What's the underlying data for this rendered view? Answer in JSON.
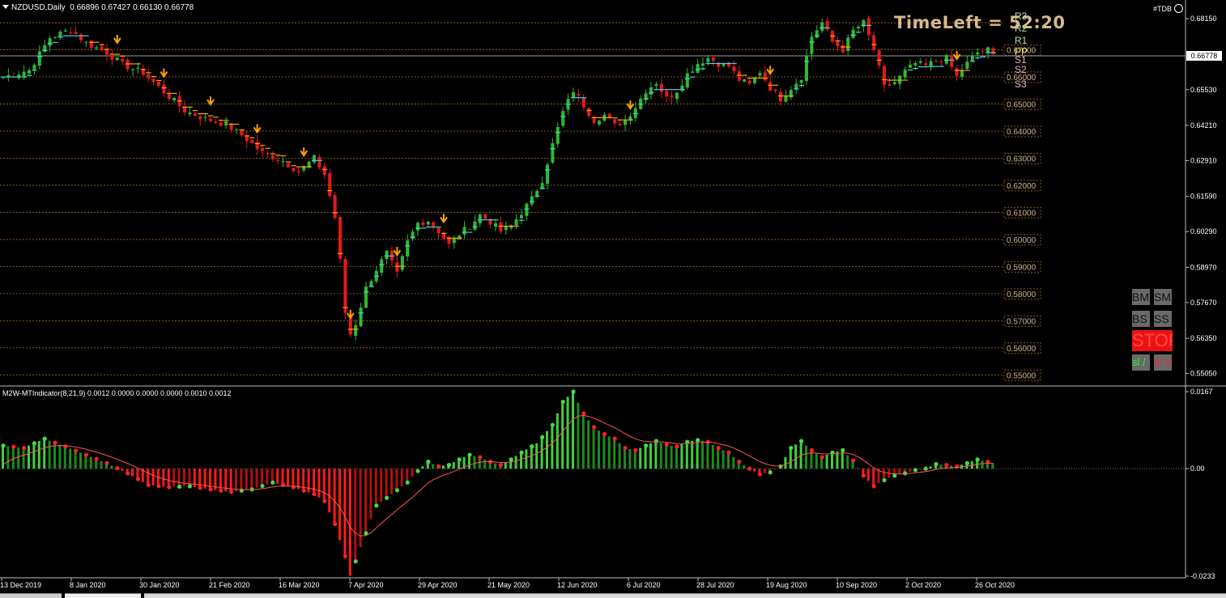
{
  "header": {
    "symbol_label": "NZDUSD,Daily",
    "ohlc": "0.66896 0.67427 0.66130 0.66778"
  },
  "indicator": {
    "title": "M2W-MTIndicator(8,21,9) 0.0012 0.0000 0.0000 0.0000 0.0010 0.0012"
  },
  "timeleft": "TimeLeft = 52:20",
  "tdb_label": "#TDB",
  "pivots": [
    {
      "label": "R3",
      "color": "#b8e0a8"
    },
    {
      "label": "R2",
      "color": "#b8e0a8"
    },
    {
      "label": "R1",
      "color": "#b8e0a8"
    },
    {
      "label": "PP",
      "color": "#f0e070"
    },
    {
      "label": "S1",
      "color": "#e8b8b8"
    },
    {
      "label": "S2",
      "color": "#e8b8b8"
    },
    {
      "label": "S3",
      "color": "#e8b8b8"
    }
  ],
  "buttons": [
    {
      "label": "BM"
    },
    {
      "label": "SM"
    },
    {
      "label": "BS"
    },
    {
      "label": "SS"
    }
  ],
  "stop_label": "STOP",
  "sl_buttons": [
    {
      "label": "sl / "
    },
    {
      "label": "sl V"
    }
  ],
  "colors": {
    "bull": "#2dbb2d",
    "bear": "#e81818",
    "ma_up": "#3ad7e8",
    "ma_down": "#ffa500",
    "grid": "#8a5a1e",
    "dot_green": "#44dd44",
    "dot_red": "#ff2020",
    "signal_line": "#ff5555"
  },
  "chart_data": [
    {
      "type": "candlestick",
      "title": "NZDUSD,Daily",
      "ylim": [
        0.5465,
        0.6845
      ],
      "price_ticks": [
        "0.68150",
        "0.66778",
        "0.65530",
        "0.64210",
        "0.62910",
        "0.61590",
        "0.60290",
        "0.58970",
        "0.57670",
        "0.56350",
        "0.55050"
      ],
      "grid_levels": [
        "0.55000",
        "0.56000",
        "0.57000",
        "0.58000",
        "0.59000",
        "0.60000",
        "0.61000",
        "0.62000",
        "0.63000",
        "0.64000",
        "0.65000",
        "0.66000",
        "0.67000",
        "0.68000"
      ],
      "grid_label_levels": [
        "0.55000",
        "0.56000",
        "0.57000",
        "0.58000",
        "0.59000",
        "0.60000",
        "0.61000",
        "0.62000",
        "0.63000",
        "0.64000",
        "0.65000",
        "0.66000",
        "0.67000"
      ],
      "current_price": "0.66778",
      "x_ticks": [
        "13 Dec 2019",
        "8 Jan 2020",
        "30 Jan 2020",
        "21 Feb 2020",
        "16 Mar 2020",
        "7 Apr 2020",
        "29 Apr 2020",
        "21 May 2020",
        "12 Jun 2020",
        "6 Jul 2020",
        "28 Jul 2020",
        "19 Aug 2020",
        "10 Sep 2020",
        "2 Oct 2020",
        "26 Oct 2020"
      ],
      "close_path": [
        [
          0,
          0.66
        ],
        [
          5,
          0.6625
        ],
        [
          9,
          0.6745
        ],
        [
          13,
          0.6775
        ],
        [
          16,
          0.6725
        ],
        [
          20,
          0.669
        ],
        [
          23,
          0.6645
        ],
        [
          27,
          0.6615
        ],
        [
          31,
          0.6545
        ],
        [
          35,
          0.6475
        ],
        [
          39,
          0.6445
        ],
        [
          43,
          0.6425
        ],
        [
          46,
          0.6385
        ],
        [
          50,
          0.632
        ],
        [
          54,
          0.629
        ],
        [
          57,
          0.625
        ],
        [
          60,
          0.63
        ],
        [
          62,
          0.624
        ],
        [
          64,
          0.608
        ],
        [
          65,
          0.592
        ],
        [
          66,
          0.573
        ],
        [
          67,
          0.565
        ],
        [
          68,
          0.569
        ],
        [
          70,
          0.582
        ],
        [
          72,
          0.589
        ],
        [
          74,
          0.595
        ],
        [
          76,
          0.587
        ],
        [
          78,
          0.599
        ],
        [
          80,
          0.606
        ],
        [
          82,
          0.607
        ],
        [
          84,
          0.603
        ],
        [
          86,
          0.598
        ],
        [
          88,
          0.602
        ],
        [
          90,
          0.605
        ],
        [
          92,
          0.609
        ],
        [
          94,
          0.6065
        ],
        [
          96,
          0.603
        ],
        [
          98,
          0.605
        ],
        [
          100,
          0.61
        ],
        [
          102,
          0.615
        ],
        [
          104,
          0.622
        ],
        [
          106,
          0.635
        ],
        [
          108,
          0.647
        ],
        [
          110,
          0.655
        ],
        [
          112,
          0.6495
        ],
        [
          114,
          0.644
        ],
        [
          116,
          0.646
        ],
        [
          118,
          0.642
        ],
        [
          120,
          0.644
        ],
        [
          122,
          0.649
        ],
        [
          124,
          0.655
        ],
        [
          126,
          0.658
        ],
        [
          128,
          0.652
        ],
        [
          130,
          0.655
        ],
        [
          132,
          0.661
        ],
        [
          134,
          0.665
        ],
        [
          136,
          0.667
        ],
        [
          138,
          0.665
        ],
        [
          140,
          0.664
        ],
        [
          142,
          0.659
        ],
        [
          144,
          0.657
        ],
        [
          146,
          0.662
        ],
        [
          148,
          0.656
        ],
        [
          150,
          0.652
        ],
        [
          152,
          0.656
        ],
        [
          154,
          0.66
        ],
        [
          156,
          0.675
        ],
        [
          158,
          0.68
        ],
        [
          160,
          0.673
        ],
        [
          162,
          0.67
        ],
        [
          164,
          0.677
        ],
        [
          166,
          0.68
        ],
        [
          168,
          0.67
        ],
        [
          170,
          0.656
        ],
        [
          172,
          0.658
        ],
        [
          174,
          0.662
        ],
        [
          176,
          0.665
        ],
        [
          178,
          0.664
        ],
        [
          180,
          0.666
        ],
        [
          182,
          0.667
        ],
        [
          184,
          0.66
        ],
        [
          186,
          0.665
        ],
        [
          188,
          0.669
        ],
        [
          190,
          0.67
        ],
        [
          191,
          0.6678
        ]
      ],
      "macd_hist_path": [
        [
          0,
          0.005
        ],
        [
          4,
          0.0045
        ],
        [
          8,
          0.0065
        ],
        [
          12,
          0.0048
        ],
        [
          16,
          0.003
        ],
        [
          20,
          0.0012
        ],
        [
          24,
          -0.001
        ],
        [
          28,
          -0.0035
        ],
        [
          32,
          -0.004
        ],
        [
          36,
          -0.0038
        ],
        [
          40,
          -0.0045
        ],
        [
          44,
          -0.005
        ],
        [
          48,
          -0.0045
        ],
        [
          52,
          -0.003
        ],
        [
          56,
          -0.004
        ],
        [
          60,
          -0.0055
        ],
        [
          62,
          -0.007
        ],
        [
          64,
          -0.012
        ],
        [
          66,
          -0.019
        ],
        [
          67,
          -0.0232
        ],
        [
          69,
          -0.017
        ],
        [
          72,
          -0.008
        ],
        [
          75,
          -0.0055
        ],
        [
          78,
          -0.003
        ],
        [
          80,
          -0.0005
        ],
        [
          82,
          0.0015
        ],
        [
          84,
          0.0005
        ],
        [
          86,
          0.0008
        ],
        [
          88,
          0.002
        ],
        [
          90,
          0.003
        ],
        [
          92,
          0.0025
        ],
        [
          94,
          0.0015
        ],
        [
          96,
          0.0008
        ],
        [
          98,
          0.002
        ],
        [
          100,
          0.0035
        ],
        [
          103,
          0.0055
        ],
        [
          106,
          0.0095
        ],
        [
          108,
          0.0145
        ],
        [
          110,
          0.0167
        ],
        [
          112,
          0.012
        ],
        [
          114,
          0.009
        ],
        [
          116,
          0.0075
        ],
        [
          118,
          0.0065
        ],
        [
          120,
          0.0045
        ],
        [
          122,
          0.004
        ],
        [
          124,
          0.005
        ],
        [
          126,
          0.006
        ],
        [
          128,
          0.0052
        ],
        [
          130,
          0.0048
        ],
        [
          132,
          0.0058
        ],
        [
          134,
          0.0062
        ],
        [
          136,
          0.0058
        ],
        [
          138,
          0.0045
        ],
        [
          140,
          0.0035
        ],
        [
          142,
          0.0015
        ],
        [
          144,
          0.0
        ],
        [
          146,
          -0.0012
        ],
        [
          148,
          -0.0008
        ],
        [
          150,
          0.0005
        ],
        [
          152,
          0.0045
        ],
        [
          154,
          0.006
        ],
        [
          156,
          0.004
        ],
        [
          158,
          0.0025
        ],
        [
          160,
          0.0035
        ],
        [
          162,
          0.004
        ],
        [
          164,
          0.0018
        ],
        [
          166,
          -0.0015
        ],
        [
          168,
          -0.0038
        ],
        [
          170,
          -0.0025
        ],
        [
          172,
          -0.0015
        ],
        [
          174,
          -0.001
        ],
        [
          176,
          -0.0003
        ],
        [
          178,
          0.0
        ],
        [
          180,
          0.001
        ],
        [
          182,
          0.0008
        ],
        [
          184,
          0.0005
        ],
        [
          186,
          0.0012
        ],
        [
          188,
          0.002
        ],
        [
          190,
          0.0015
        ],
        [
          191,
          0.0012
        ]
      ]
    },
    {
      "type": "bar",
      "title": "M2W-MTIndicator(8,21,9)",
      "ylim": [
        -0.0233,
        0.0167
      ],
      "y_ticks": [
        "0.0167",
        "0.00",
        "-0.0233"
      ]
    }
  ]
}
